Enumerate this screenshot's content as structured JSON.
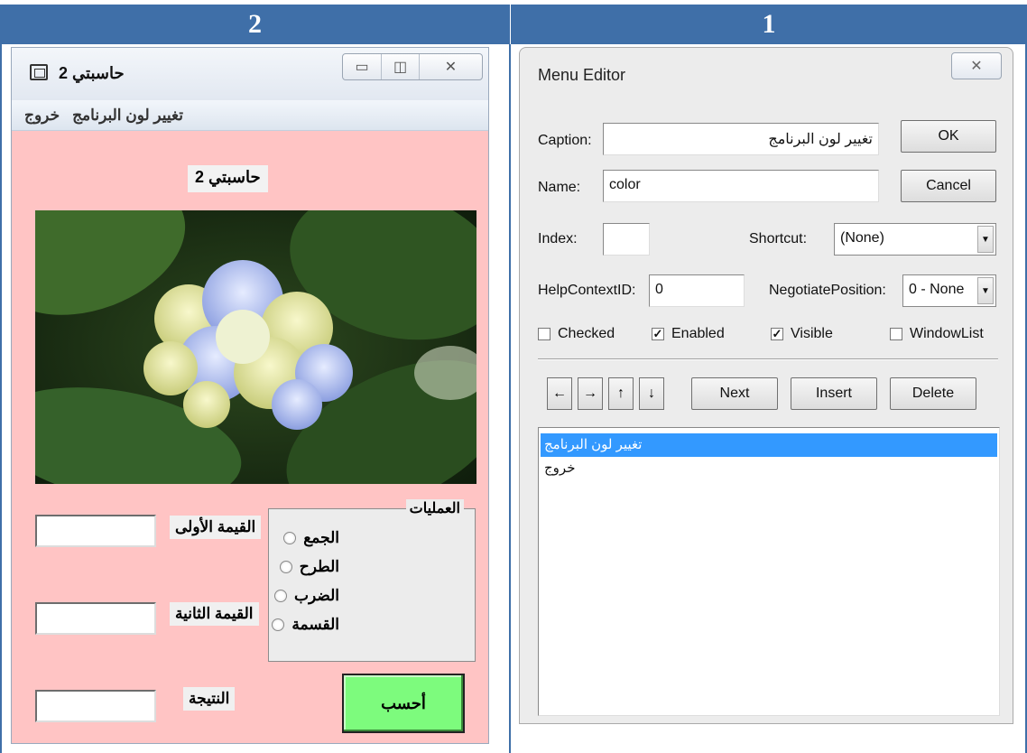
{
  "headers": {
    "left": "2",
    "right": "1"
  },
  "calculator": {
    "window_title": "حاسبتي 2",
    "menu": [
      "تغيير لون البرنامج",
      "خروج"
    ],
    "form_title": "حاسبتي 2",
    "operations_legend": "العمليات",
    "operations": [
      "الجمع",
      "الطرح",
      "الضرب",
      "القسمة"
    ],
    "labels": {
      "first_value": "القيمة الأولى",
      "second_value": "القيمة الثانية",
      "result": "النتيجة"
    },
    "calculate_button": "أحسب",
    "colors": {
      "background": "#ffc4c4",
      "button": "#7dfb7d"
    },
    "image": "hydrangea-flower-photo"
  },
  "menu_editor": {
    "title": "Menu Editor",
    "caption_label": "Caption:",
    "caption_value": "تغيير لون البرنامج",
    "name_label": "Name:",
    "name_value": "color",
    "index_label": "Index:",
    "index_value": "",
    "shortcut_label": "Shortcut:",
    "shortcut_value": "(None)",
    "helpcontext_label": "HelpContextID:",
    "helpcontext_value": "0",
    "negotiate_label": "NegotiatePosition:",
    "negotiate_value": "0 - None",
    "ok": "OK",
    "cancel": "Cancel",
    "checkboxes": [
      {
        "label": "Checked",
        "checked": false
      },
      {
        "label": "Enabled",
        "checked": true
      },
      {
        "label": "Visible",
        "checked": true
      },
      {
        "label": "WindowList",
        "checked": false
      }
    ],
    "next": "Next",
    "insert": "Insert",
    "delete": "Delete",
    "list_items": [
      "تغيير لون البرنامج",
      "خروج"
    ]
  }
}
